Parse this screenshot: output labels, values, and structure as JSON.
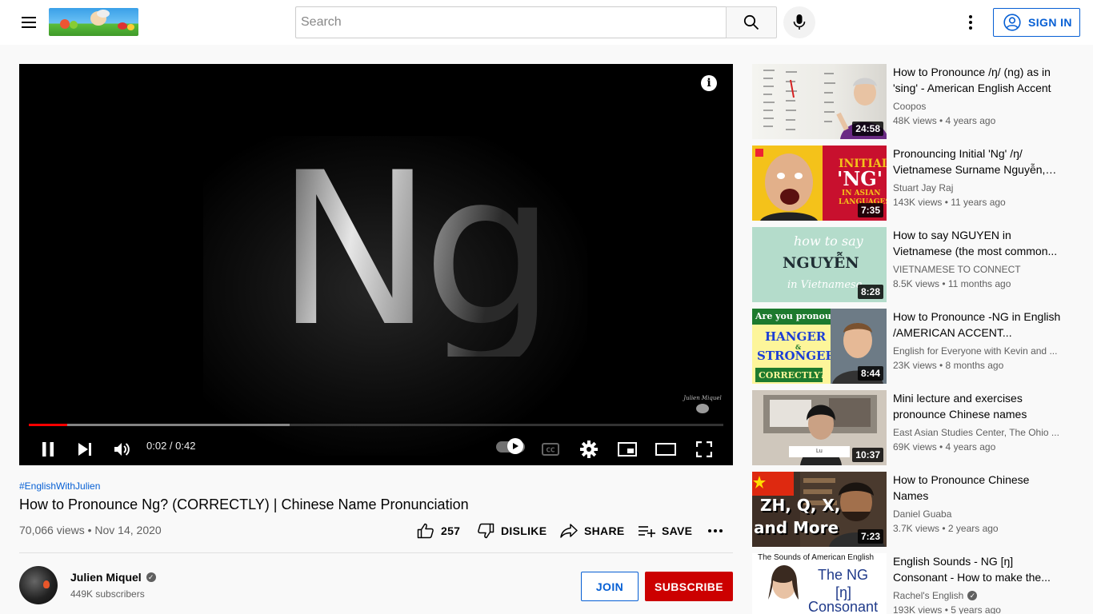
{
  "header": {
    "search_placeholder": "Search",
    "signin_label": "SIGN IN"
  },
  "player": {
    "overlay_text": "Ng",
    "watermark": "Julien Miquel",
    "time": "0:02 / 0:42",
    "progress": {
      "played": 0.055,
      "loaded": 0.375
    }
  },
  "video": {
    "hashtag": "#EnglishWithJulien",
    "title": "How to Pronounce Ng? (CORRECTLY) | Chinese Name Pronunciation",
    "meta": "70,066 views • Nov 14, 2020",
    "like_count": "257",
    "dislike_label": "DISLIKE",
    "share_label": "SHARE",
    "save_label": "SAVE"
  },
  "channel": {
    "name": "Julien Miquel",
    "subscribers": "449K subscribers",
    "join_label": "JOIN",
    "subscribe_label": "SUBSCRIBE"
  },
  "recommendations": [
    {
      "title": "How to Pronounce /ŋ/ (ng) as in 'sing' - American English Accent",
      "channel": "Coopos",
      "verified": false,
      "meta": "48K views • 4 years ago",
      "duration": "24:58"
    },
    {
      "title": "Pronouncing Initial 'Ng' /ŋ/ Vietnamese Surname Nguyễn, Ng...",
      "channel": "Stuart Jay Raj",
      "verified": false,
      "meta": "143K views • 11 years ago",
      "duration": "7:35",
      "thumb_text": [
        "INITIAL",
        "'NG'",
        "IN ASIAN",
        "LANGUAGES"
      ]
    },
    {
      "title": "How to say NGUYEN in Vietnamese (the most common...",
      "channel": "VIETNAMESE TO CONNECT",
      "verified": false,
      "meta": "8.5K views • 11 months ago",
      "duration": "8:28",
      "thumb_text": [
        "how to say",
        "NGUYỄN",
        "in Vietnamese"
      ]
    },
    {
      "title": "How to Pronounce -NG in English /AMERICAN ACCENT...",
      "channel": "English for Everyone with Kevin and ...",
      "verified": false,
      "meta": "23K views • 8 months ago",
      "duration": "8:44",
      "thumb_text": [
        "Are you pronouncing",
        "HANGER",
        "&",
        "STRONGER",
        "CORRECTLY?"
      ]
    },
    {
      "title": "Mini lecture and exercises pronounce Chinese names",
      "channel": "East Asian Studies Center, The Ohio ...",
      "verified": false,
      "meta": "69K views • 4 years ago",
      "duration": "10:37",
      "thumb_text": [
        "Lu"
      ]
    },
    {
      "title": "How to Pronounce Chinese Names",
      "channel": "Daniel Guaba",
      "verified": false,
      "meta": "3.7K views • 2 years ago",
      "duration": "7:23",
      "thumb_text": [
        "ZH, Q, X,",
        "and More"
      ]
    },
    {
      "title": "English Sounds - NG [ŋ] Consonant - How to make the...",
      "channel": "Rachel's English",
      "verified": true,
      "meta": "193K views • 5 years ago",
      "duration": "",
      "thumb_text": [
        "The Sounds of American English",
        "The NG",
        "[ŋ]",
        "Consonant"
      ]
    }
  ],
  "colors": {
    "accent": "#065fd4",
    "subscribe": "#cc0000",
    "progress": "#ff0000"
  }
}
